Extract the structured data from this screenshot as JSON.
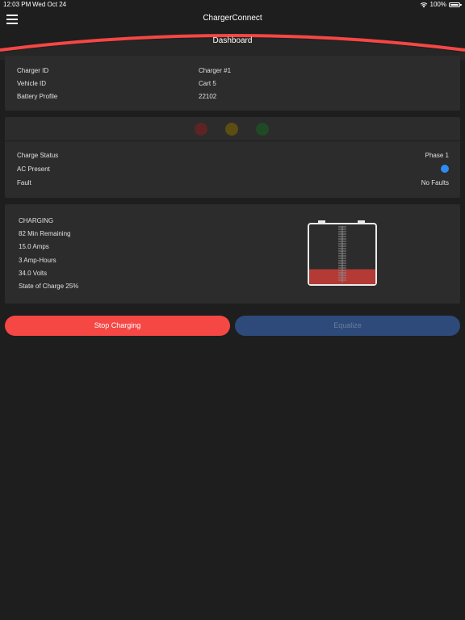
{
  "status_bar": {
    "time": "12:03 PM",
    "date": "Wed Oct 24",
    "battery": "100%"
  },
  "header": {
    "app_title": "ChargerConnect",
    "page_title": "Dashboard"
  },
  "info": {
    "charger_id_label": "Charger ID",
    "charger_id_value": "Charger #1",
    "vehicle_id_label": "Vehicle ID",
    "vehicle_id_value": "Cart 5",
    "battery_profile_label": "Battery Profile",
    "battery_profile_value": "22102"
  },
  "status": {
    "leds": {
      "red": "#5c2424",
      "yellow": "#5c4d12",
      "green": "#1f4a25"
    },
    "charge_status_label": "Charge Status",
    "charge_status_value": "Phase 1",
    "ac_present_label": "AC Present",
    "ac_present_color": "#2f8bf2",
    "fault_label": "Fault",
    "fault_value": "No Faults"
  },
  "charge": {
    "state": "CHARGING",
    "remaining": "82 Min Remaining",
    "amps": "15.0 Amps",
    "amp_hours": "3 Amp-Hours",
    "volts": "34.0 Volts",
    "soc": "State of Charge 25%",
    "soc_fraction": 0.25
  },
  "buttons": {
    "stop": "Stop Charging",
    "equalize": "Equalize"
  },
  "colors": {
    "accent_red": "#f54744",
    "equalize_blue": "#2d4a7a",
    "background": "#1e1e1e",
    "card": "#2c2c2c"
  }
}
